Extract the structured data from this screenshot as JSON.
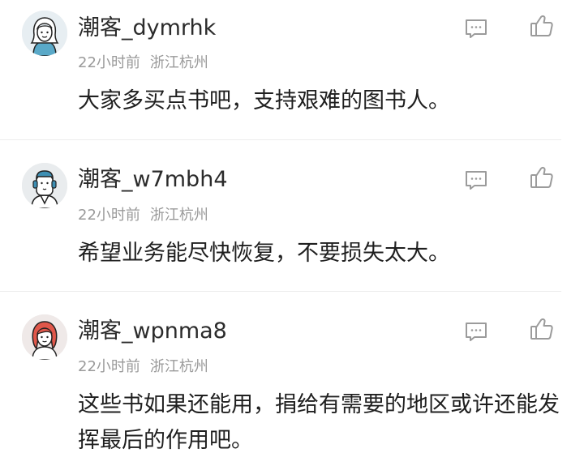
{
  "comments": [
    {
      "username": "潮客_dymrhk",
      "time": "22小时前",
      "location": "浙江杭州",
      "text": "大家多买点书吧，支持艰难的图书人。"
    },
    {
      "username": "潮客_w7mbh4",
      "time": "22小时前",
      "location": "浙江杭州",
      "text": "希望业务能尽快恢复，不要损失太大。"
    },
    {
      "username": "潮客_wpnma8",
      "time": "22小时前",
      "location": "浙江杭州",
      "text": "这些书如果还能用，捐给有需要的地区或许还能发挥最后的作用吧。"
    }
  ],
  "icons": {
    "reply": "reply-icon",
    "like": "thumbs-up-icon"
  },
  "colors": {
    "username": "#2b2b2b",
    "meta": "#9a9a9a",
    "icon": "#9b9b9b",
    "divider": "#ececec"
  }
}
